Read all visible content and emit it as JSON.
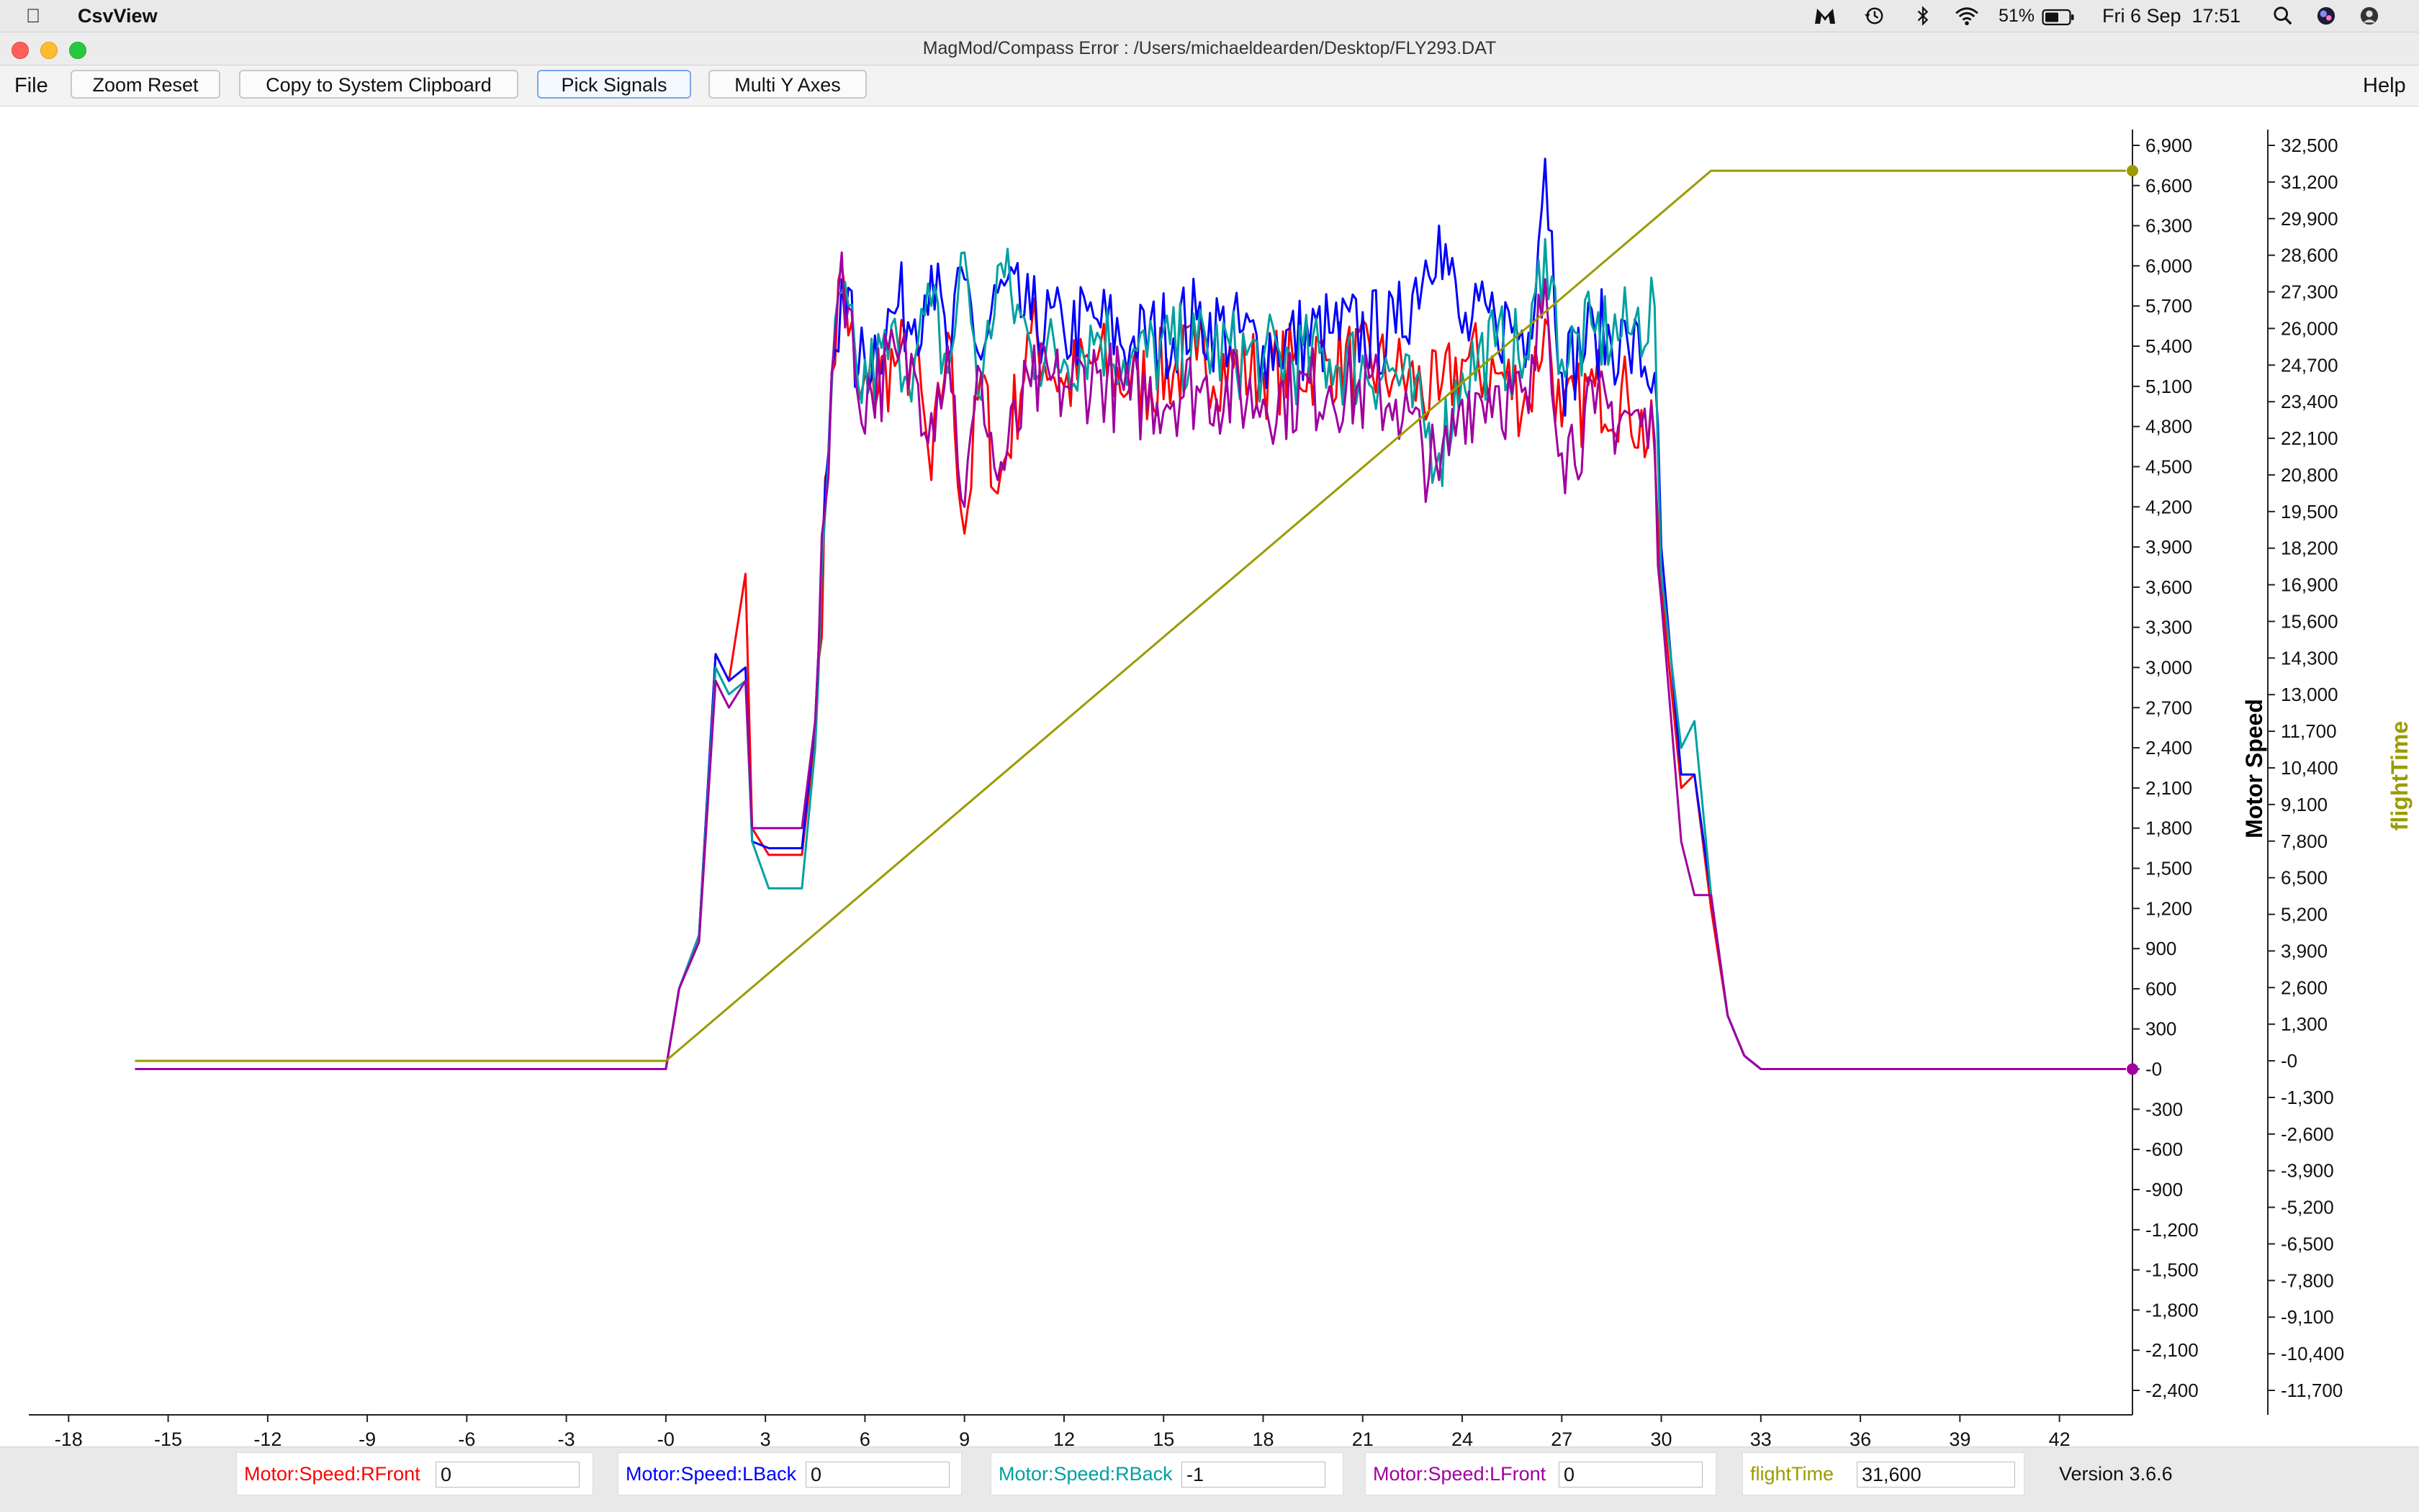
{
  "menubar": {
    "app_name": "CsvView",
    "battery": "51%",
    "datetime": "Fri 6 Sep  17:51",
    "icons": [
      "apple-icon",
      "malwarebytes-icon",
      "time-machine-icon",
      "bluetooth-icon",
      "wifi-icon",
      "battery-icon",
      "search-icon",
      "siri-icon"
    ]
  },
  "window": {
    "title": "MagMod/Compass Error : /Users/michaeldearden/Desktop/FLY293.DAT"
  },
  "toolbar": {
    "file": "File",
    "zoom_reset": "Zoom Reset",
    "copy": "Copy to System Clipboard",
    "pick_signals": "Pick Signals",
    "multi_y": "Multi Y Axes",
    "help": "Help"
  },
  "status": {
    "signals": [
      {
        "label": "Motor:Speed:RFront",
        "value": "0",
        "color": "#ff0000"
      },
      {
        "label": "Motor:Speed:LBack",
        "value": "0",
        "color": "#0000ff"
      },
      {
        "label": "Motor:Speed:RBack",
        "value": "-1",
        "color": "#00a0a0"
      },
      {
        "label": "Motor:Speed:LFront",
        "value": "0",
        "color": "#a000a0"
      },
      {
        "label": "flightTime",
        "value": "31,600",
        "color": "#9b9b00"
      }
    ],
    "version": "Version 3.6.6"
  },
  "chart_data": {
    "type": "line",
    "x_ticks": [
      "-18",
      "-15",
      "-12",
      "-9",
      "-6",
      "-3",
      "-0",
      "3",
      "6",
      "9",
      "12",
      "15",
      "18",
      "21",
      "24",
      "27",
      "30",
      "33",
      "36",
      "39",
      "42"
    ],
    "xlim": [
      -19.2,
      44.2
    ],
    "axes": [
      {
        "label": "Motor Speed",
        "ylim": [
          -2600,
          7050
        ],
        "ticks": [
          "6,900",
          "6,600",
          "6,300",
          "6,000",
          "5,700",
          "5,400",
          "5,100",
          "4,800",
          "4,500",
          "4,200",
          "3,900",
          "3,600",
          "3,300",
          "3,000",
          "2,700",
          "2,400",
          "2,100",
          "1,800",
          "1,500",
          "1,200",
          "900",
          "600",
          "300",
          "-0",
          "-300",
          "-600",
          "-900",
          "-1,200",
          "-1,500",
          "-1,800",
          "-2,100",
          "-2,400"
        ]
      },
      {
        "label": "flightTime",
        "ylim": [
          -12200,
          33200
        ],
        "ticks": [
          "32,500",
          "31,200",
          "29,900",
          "28,600",
          "27,300",
          "26,000",
          "24,700",
          "23,400",
          "22,100",
          "20,800",
          "19,500",
          "18,200",
          "16,900",
          "15,600",
          "14,300",
          "13,000",
          "11,700",
          "10,400",
          "9,100",
          "7,800",
          "6,500",
          "5,200",
          "3,900",
          "2,600",
          "1,300",
          "-0",
          "-1,300",
          "-2,600",
          "-3,900",
          "-5,200",
          "-6,500",
          "-7,800",
          "-9,100",
          "-10,400",
          "-11,700"
        ]
      }
    ],
    "series": [
      {
        "name": "Motor:Speed:RFront",
        "color": "#ff0000",
        "axis": 0,
        "x": [
          -16,
          0,
          0.4,
          1,
          1.5,
          1.9,
          2.4,
          2.6,
          3.1,
          4.1,
          4.5,
          5,
          5.3,
          5.8,
          7,
          7.5,
          8,
          8.5,
          9,
          9.5,
          10,
          11,
          12,
          13,
          14,
          16,
          18,
          20,
          22,
          23.3,
          24,
          25,
          26,
          26.5,
          27,
          28,
          29,
          29.8,
          30,
          30.6,
          31,
          31.5,
          32,
          32.5,
          33,
          44
        ],
        "y": [
          0,
          0,
          600,
          1000,
          3100,
          2900,
          3700,
          1800,
          1600,
          1600,
          2500,
          5200,
          6000,
          5000,
          5300,
          5300,
          4400,
          5500,
          4000,
          5200,
          4300,
          5500,
          5100,
          5300,
          5100,
          5300,
          5200,
          5300,
          5200,
          5000,
          5300,
          5200,
          5000,
          5600,
          4800,
          5100,
          5000,
          4600,
          3600,
          2100,
          2200,
          1200,
          400,
          100,
          0,
          0
        ]
      },
      {
        "name": "Motor:Speed:LBack",
        "color": "#0000ff",
        "axis": 0,
        "x": [
          -16,
          0,
          0.4,
          1,
          1.5,
          1.9,
          2.4,
          2.6,
          3.1,
          4.1,
          4.5,
          5,
          5.3,
          5.8,
          7,
          7.5,
          8,
          8.5,
          9,
          9.5,
          10,
          11,
          12,
          13,
          14,
          16,
          18,
          20,
          22,
          23.3,
          24,
          25,
          26,
          26.5,
          27,
          28,
          29,
          29.8,
          30,
          30.6,
          31,
          31.5,
          32,
          32.5,
          33,
          44
        ],
        "y": [
          0,
          0,
          600,
          1000,
          3100,
          2900,
          3000,
          1700,
          1650,
          1650,
          2600,
          5200,
          5900,
          5200,
          5700,
          5600,
          6000,
          5300,
          5900,
          5300,
          5800,
          5600,
          5500,
          5600,
          5400,
          5600,
          5400,
          5500,
          5500,
          6300,
          5500,
          5600,
          5500,
          6800,
          5200,
          5500,
          5400,
          5200,
          3900,
          2200,
          2200,
          1300,
          400,
          100,
          0,
          0
        ]
      },
      {
        "name": "Motor:Speed:RBack",
        "color": "#00a0a0",
        "axis": 0,
        "x": [
          -16,
          0,
          0.4,
          1,
          1.5,
          1.9,
          2.4,
          2.6,
          3.1,
          4.1,
          4.5,
          5,
          5.3,
          5.8,
          7,
          7.5,
          8,
          8.5,
          9,
          9.5,
          10,
          11,
          12,
          13,
          14,
          16,
          18,
          20,
          22,
          23.3,
          24,
          25,
          26,
          26.5,
          27,
          28,
          29,
          29.8,
          30,
          30.6,
          31,
          31.5,
          32,
          32.5,
          33,
          44
        ],
        "y": [
          0,
          0,
          600,
          1000,
          3000,
          2800,
          2900,
          1700,
          1350,
          1350,
          2400,
          5100,
          5800,
          5100,
          5400,
          5300,
          5700,
          5200,
          6100,
          5000,
          6000,
          5400,
          5300,
          5500,
          5300,
          5400,
          5300,
          5300,
          5200,
          4600,
          5200,
          5400,
          5300,
          6200,
          5300,
          5500,
          5500,
          5700,
          3700,
          2400,
          2600,
          1300,
          400,
          100,
          0,
          0
        ]
      },
      {
        "name": "Motor:Speed:LFront",
        "color": "#a000a0",
        "axis": 0,
        "x": [
          -16,
          0,
          0.4,
          1,
          1.5,
          1.9,
          2.4,
          2.6,
          3.1,
          4.1,
          4.5,
          5,
          5.3,
          5.8,
          7,
          7.5,
          8,
          8.5,
          9,
          9.5,
          10,
          11,
          12,
          13,
          14,
          16,
          18,
          20,
          22,
          23.3,
          24,
          25,
          26,
          26.5,
          27,
          28,
          29,
          29.8,
          30,
          30.6,
          31,
          31.5,
          32,
          32.5,
          33,
          44
        ],
        "y": [
          0,
          0,
          600,
          950,
          2900,
          2700,
          2900,
          1800,
          1800,
          1800,
          2600,
          5200,
          6100,
          5000,
          5300,
          5200,
          4900,
          5400,
          4200,
          5200,
          4400,
          5100,
          5100,
          5200,
          5000,
          5100,
          5000,
          5100,
          5000,
          4400,
          5000,
          5100,
          4900,
          5900,
          4600,
          4900,
          4900,
          4700,
          3500,
          1700,
          1300,
          1300,
          400,
          100,
          0,
          0
        ]
      },
      {
        "name": "flightTime",
        "color": "#9b9b00",
        "axis": 1,
        "x": [
          -16,
          0,
          31.5,
          44
        ],
        "y": [
          0,
          0,
          31600,
          31600
        ]
      }
    ]
  }
}
